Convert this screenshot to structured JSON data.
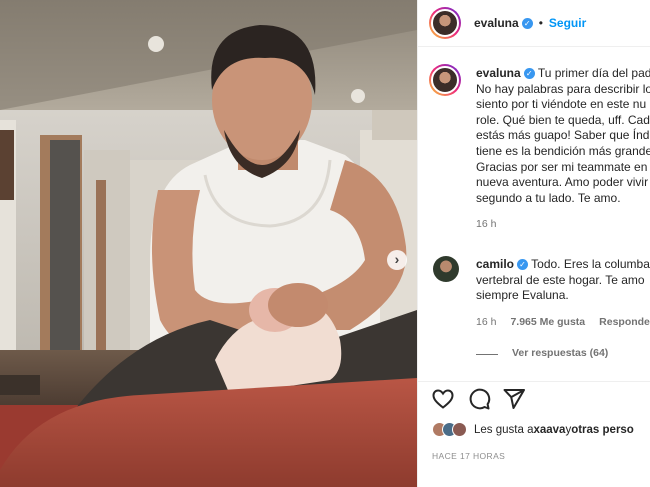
{
  "header": {
    "username": "evaluna",
    "separator": "•",
    "follow_label": "Seguir"
  },
  "caption": {
    "username": "evaluna",
    "lines": [
      "Tu primer día del pad",
      "No hay palabras para describir lo",
      "siento por ti viéndote en este nu",
      "role. Qué bien te queda, uff. Cad",
      "estás más guapo! Saber que Índi",
      "tiene es la bendición más grande",
      "Gracias por ser mi teammate en",
      "nueva aventura. Amo poder vivir",
      "segundo a tu lado. Te amo."
    ],
    "time": "16 h"
  },
  "comment": {
    "username": "camilo",
    "lines": [
      "Todo. Eres la columba",
      "vertebral de este hogar. Te amo",
      "siempre Evaluna."
    ],
    "time": "16 h",
    "likes": "7.965 Me gusta",
    "reply": "Responder",
    "view_replies": "Ver respuestas (64)"
  },
  "likes_text": {
    "prefix": "Les gusta a ",
    "user": "xaava",
    "middle": " y ",
    "others": "otras perso"
  },
  "post_time": "HACE 17 HORAS",
  "icons": {
    "next": "chevron-right-icon",
    "like": "heart-icon",
    "comment": "comment-icon",
    "share": "paper-plane-icon",
    "verified": "verified-badge-icon"
  },
  "colors": {
    "follow": "#0095f6",
    "verified": "#3897f0",
    "meta": "#737373"
  }
}
